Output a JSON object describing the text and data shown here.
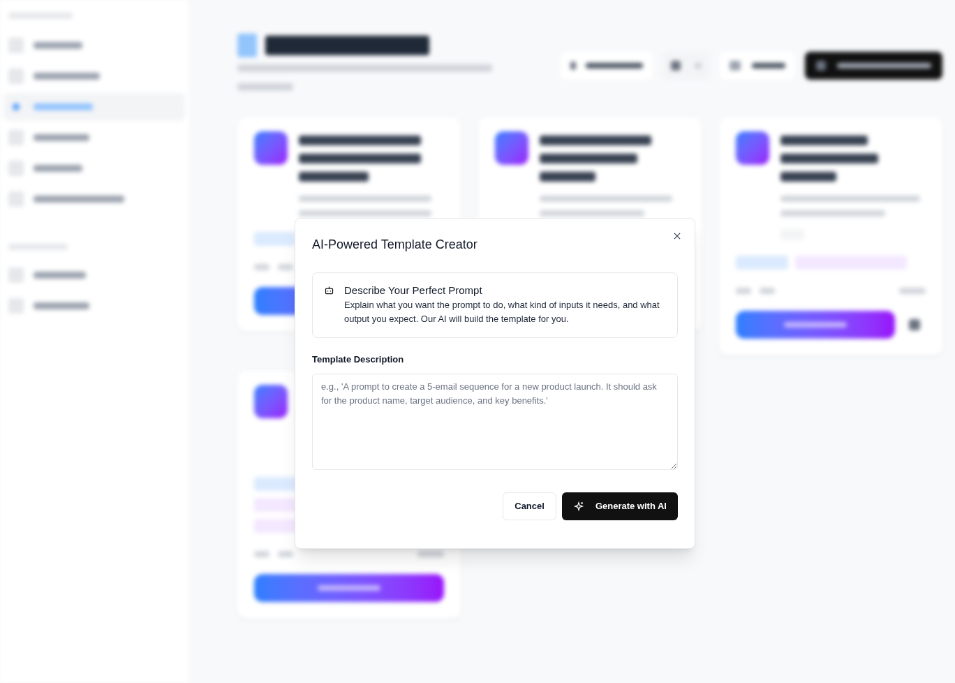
{
  "modal": {
    "title": "AI-Powered Template Creator",
    "info": {
      "heading": "Describe Your Perfect Prompt",
      "text": "Explain what you want the prompt to do, what kind of inputs it needs, and what output you expect. Our AI will build the template for you."
    },
    "field_label": "Template Description",
    "placeholder": "e.g., 'A prompt to create a 5-email sequence for a new product launch. It should ask for the product name, target audience, and key benefits.'",
    "buttons": [
      {
        "kind": "secondary",
        "label": "Cancel"
      },
      {
        "kind": "primary",
        "label": "Generate with AI"
      }
    ]
  }
}
